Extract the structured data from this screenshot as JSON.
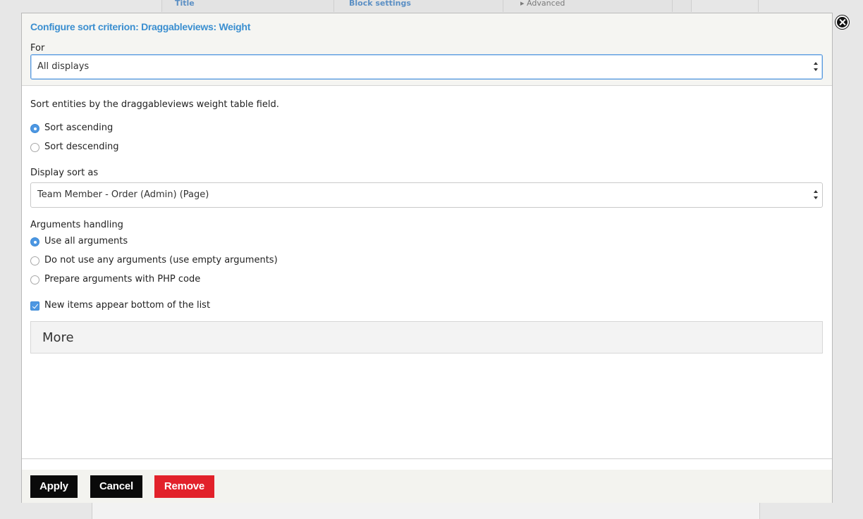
{
  "background": {
    "columns": [
      "Title",
      "Block settings",
      "Advanced"
    ]
  },
  "dialog": {
    "title": "Configure sort criterion: Draggableviews: Weight",
    "for_label": "For",
    "for_value": "All displays",
    "description": "Sort entities by the draggableviews weight table field.",
    "sort_options": [
      {
        "label": "Sort ascending",
        "checked": true
      },
      {
        "label": "Sort descending",
        "checked": false
      }
    ],
    "display_sort_label": "Display sort as",
    "display_sort_value": "Team Member - Order (Admin) (Page)",
    "arguments_label": "Arguments handling",
    "arguments_options": [
      {
        "label": "Use all arguments",
        "checked": true
      },
      {
        "label": "Do not use any arguments (use empty arguments)",
        "checked": false
      },
      {
        "label": "Prepare arguments with PHP code",
        "checked": false
      }
    ],
    "new_items_label": "New items appear bottom of the list",
    "new_items_checked": true,
    "more_label": "More",
    "buttons": {
      "apply": "Apply",
      "cancel": "Cancel",
      "remove": "Remove"
    }
  },
  "colors": {
    "accent": "#3b8fd0",
    "remove_button": "#e2212a",
    "primary_button": "#0a0a0a"
  }
}
